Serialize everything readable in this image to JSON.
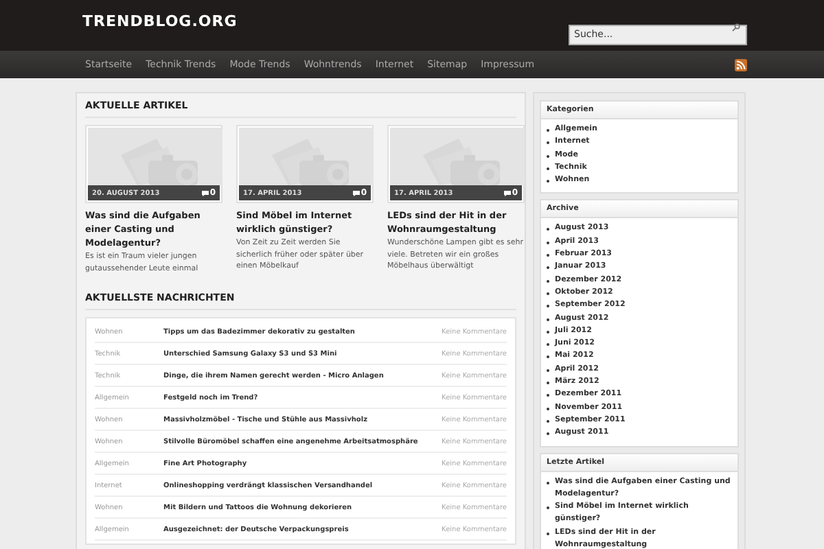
{
  "site_title": "TRENDBLOG.ORG",
  "search": {
    "placeholder": "Suche..."
  },
  "nav": [
    {
      "label": "Startseite"
    },
    {
      "label": "Technik Trends"
    },
    {
      "label": "Mode Trends"
    },
    {
      "label": "Wohntrends"
    },
    {
      "label": "Internet"
    },
    {
      "label": "Sitemap"
    },
    {
      "label": "Impressum"
    }
  ],
  "featured": {
    "heading": "AKTUELLE ARTIKEL",
    "articles": [
      {
        "date": "20. AUGUST 2013",
        "comments": "0",
        "title": "Was sind die Aufgaben einer Casting und Modelagentur?",
        "excerpt": "Es ist ein Traum vieler jungen gutaussehender Leute einmal"
      },
      {
        "date": "17. APRIL 2013",
        "comments": "0",
        "title": "Sind Möbel im Internet wirklich günstiger?",
        "excerpt": "Von Zeit zu Zeit werden Sie sicherlich früher oder später über einen Möbelkauf"
      },
      {
        "date": "17. APRIL 2013",
        "comments": "0",
        "title": "LEDs sind der Hit in der Wohnraumgestaltung",
        "excerpt": "Wunderschöne Lampen gibt es sehr viele. Betreten wir ein großes Möbelhaus überwältigt"
      }
    ]
  },
  "news": {
    "heading": "AKTUELLSTE NACHRICHTEN",
    "rows": [
      {
        "category": "Wohnen",
        "title": "Tipps um das Badezimmer dekorativ zu gestalten",
        "comments": "Keine Kommentare"
      },
      {
        "category": "Technik",
        "title": "Unterschied Samsung Galaxy S3 und S3 Mini",
        "comments": "Keine Kommentare"
      },
      {
        "category": "Technik",
        "title": "Dinge, die ihrem Namen gerecht werden - Micro Anlagen",
        "comments": "Keine Kommentare"
      },
      {
        "category": "Allgemein",
        "title": "Festgeld noch im Trend?",
        "comments": "Keine Kommentare"
      },
      {
        "category": "Wohnen",
        "title": "Massivholzmöbel - Tische und Stühle aus Massivholz",
        "comments": "Keine Kommentare"
      },
      {
        "category": "Wohnen",
        "title": "Stilvolle Büromöbel schaffen eine angenehme Arbeitsatmosphäre",
        "comments": "Keine Kommentare"
      },
      {
        "category": "Allgemein",
        "title": "Fine Art Photography",
        "comments": "Keine Kommentare"
      },
      {
        "category": "Internet",
        "title": "Onlineshopping verdrängt klassischen Versandhandel",
        "comments": "Keine Kommentare"
      },
      {
        "category": "Wohnen",
        "title": "Mit Bildern und Tattoos die Wohnung dekorieren",
        "comments": "Keine Kommentare"
      },
      {
        "category": "Allgemein",
        "title": "Ausgezeichnet: der Deutsche Verpackungspreis",
        "comments": "Keine Kommentare"
      }
    ]
  },
  "sidebar": [
    {
      "title": "Kategorien",
      "items": [
        "Allgemein",
        "Internet",
        "Mode",
        "Technik",
        "Wohnen"
      ]
    },
    {
      "title": "Archive",
      "items": [
        "August 2013",
        "April 2013",
        "Februar 2013",
        "Januar 2013",
        "Dezember 2012",
        "Oktober 2012",
        "September 2012",
        "August 2012",
        "Juli 2012",
        "Juni 2012",
        "Mai 2012",
        "April 2012",
        "März 2012",
        "Dezember 2011",
        "November 2011",
        "September 2011",
        "August 2011"
      ]
    },
    {
      "title": "Letzte Artikel",
      "items": [
        "Was sind die Aufgaben einer Casting und Modelagentur?",
        "Sind Möbel im Internet wirklich günstiger?",
        "LEDs sind der Hit in der Wohnraumgestaltung"
      ]
    }
  ]
}
